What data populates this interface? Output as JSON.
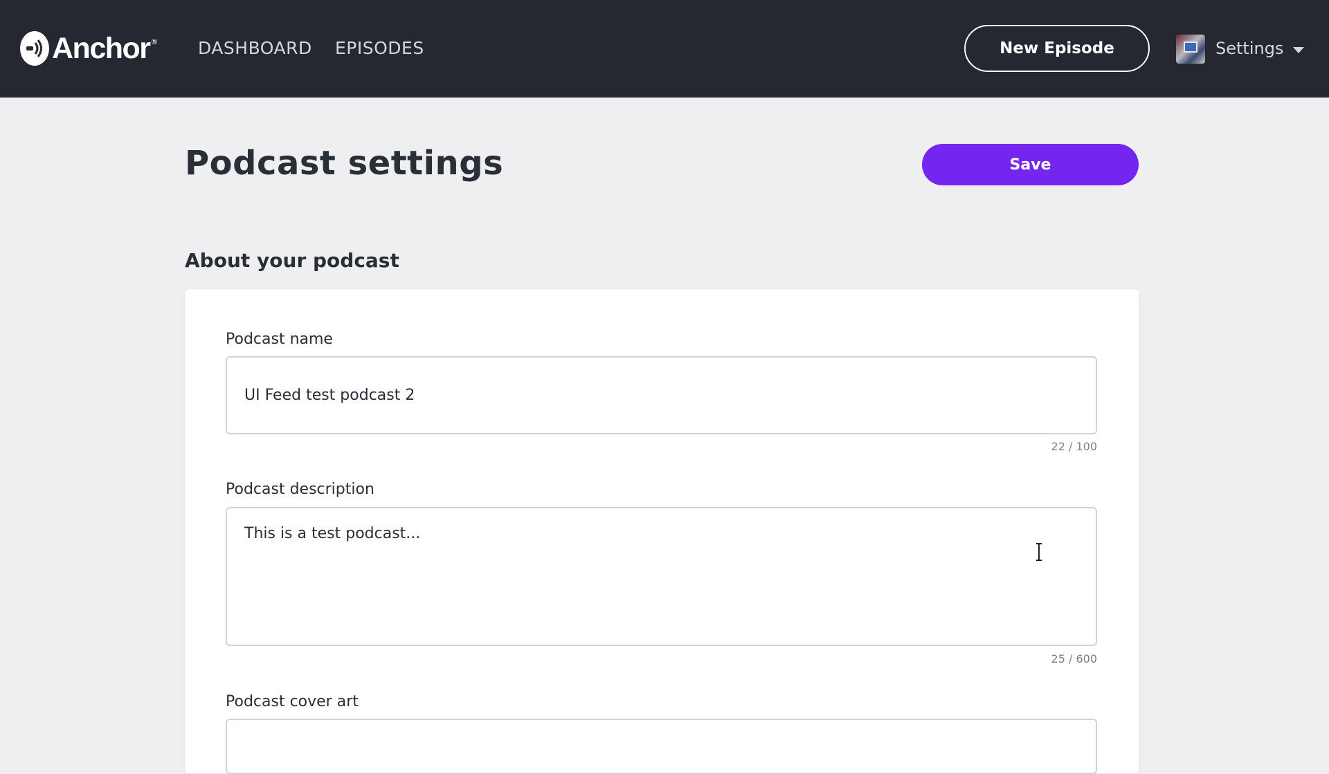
{
  "header": {
    "logo_text": "Anchor",
    "logo_reg": "®",
    "nav": [
      {
        "label": "DASHBOARD"
      },
      {
        "label": "EPISODES"
      }
    ],
    "new_episode_label": "New Episode",
    "settings_label": "Settings"
  },
  "page": {
    "title": "Podcast settings",
    "save_label": "Save",
    "section_title": "About your podcast"
  },
  "form": {
    "name": {
      "label": "Podcast name",
      "value": "UI Feed test podcast 2",
      "counter": "22 / 100"
    },
    "description": {
      "label": "Podcast description",
      "value": "This is a test podcast...",
      "counter": "25 / 600"
    },
    "cover_art": {
      "label": "Podcast cover art"
    }
  },
  "colors": {
    "topbar": "#252830",
    "accent": "#7426ee",
    "background": "#efeff1"
  },
  "icons": {
    "logo": "anchor-logo-icon",
    "caret": "chevron-down-icon",
    "cursor": "text-cursor-icon"
  }
}
